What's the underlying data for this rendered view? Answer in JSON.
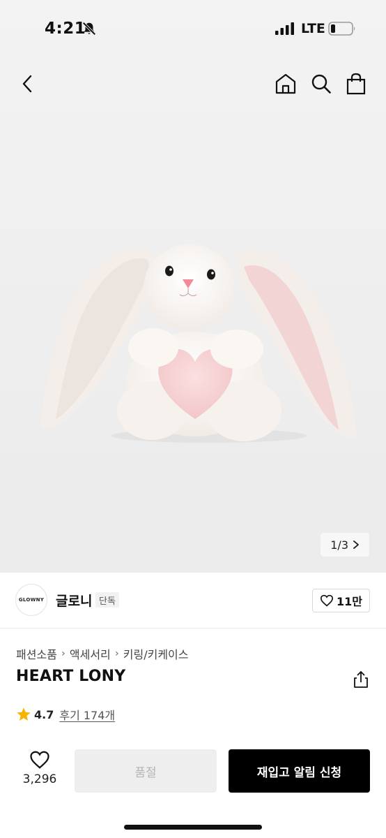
{
  "status_bar": {
    "time": "4:21",
    "network": "LTE"
  },
  "gallery": {
    "page_indicator": "1/3"
  },
  "brand": {
    "logo_text": "GLOWNY",
    "name": "글로니",
    "badge": "단독",
    "like_count": "11만"
  },
  "breadcrumb": [
    "패션소품",
    "액세서리",
    "키링/키케이스"
  ],
  "product": {
    "title": "HEART LONY",
    "rating": "4.7",
    "reviews": "후기 174개"
  },
  "bottom_bar": {
    "wish_count": "3,296",
    "soldout_label": "품절",
    "notify_label": "재입고 알림 신청"
  },
  "colors": {
    "accent": "#000000",
    "star": "#f5b400",
    "soldout_bg": "#eeeeee"
  },
  "icons": [
    "bell-slash-icon",
    "signal-icon",
    "battery-icon",
    "back-icon",
    "home-icon",
    "search-icon",
    "bag-icon",
    "heart-icon",
    "share-icon",
    "star-icon",
    "chevron-right-icon"
  ]
}
